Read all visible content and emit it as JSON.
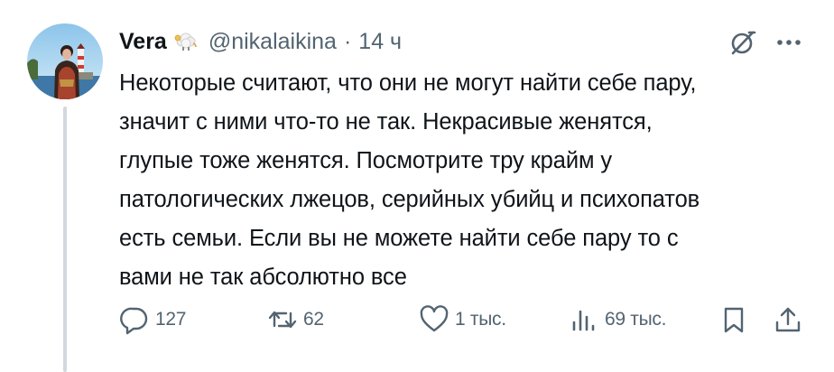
{
  "author": {
    "display_name": "Vera",
    "handle": "@nikalaikina",
    "separator": "·",
    "time": "14 ч",
    "badge_emoji": "sheep-emoji"
  },
  "post": {
    "lines": [
      "Некоторые считают, что они не могут найти себе пару,",
      "значит с ними что-то не так. Некрасивые женятся,",
      "глупые тоже женятся. Посмотрите тру крайм у",
      "патологических лжецов, серийных убийц и психопатов",
      "есть семьи. Если вы не можете найти себе пару то с",
      "вами не так абсолютно все"
    ]
  },
  "actions": {
    "replies": "127",
    "reposts": "62",
    "likes": "1 тыс.",
    "views": "69 тыс."
  },
  "colors": {
    "text": "#0f1419",
    "secondary": "#536471",
    "thread_line": "#cfd9de",
    "background": "#ffffff"
  },
  "icons": [
    "grok-icon",
    "more-icon",
    "reply-icon",
    "repost-icon",
    "like-icon",
    "views-icon",
    "bookmark-icon",
    "share-icon"
  ]
}
